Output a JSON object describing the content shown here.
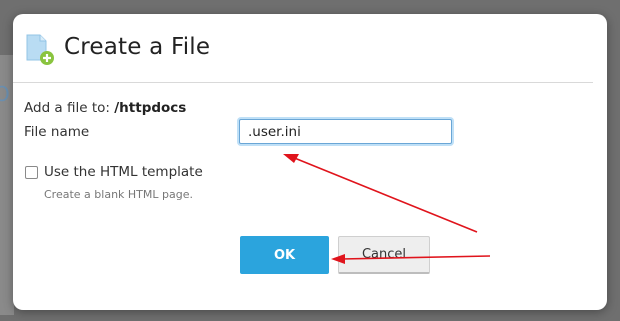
{
  "dialog": {
    "title": "Create a File",
    "add_prefix": "Add a file to:",
    "add_path": "/httpdocs",
    "filename_label": "File name",
    "filename_value": ".user.ini",
    "template_checkbox_label": "Use the HTML template",
    "template_checked": false,
    "template_hint": "Create a blank HTML page.",
    "ok_label": "OK",
    "cancel_label": "Cancel"
  },
  "icons": {
    "header": "new-file-icon"
  },
  "colors": {
    "ok_button": "#2ba4dd",
    "annotation_arrow": "#e0141c",
    "input_focus": "#bfe0f7"
  }
}
